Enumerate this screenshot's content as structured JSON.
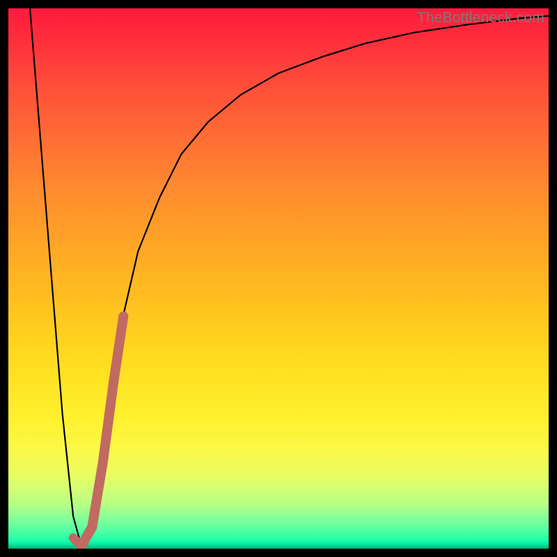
{
  "watermark": "TheBottleneck.com",
  "colors": {
    "thin_curve": "#000000",
    "thick_segment": "#c16a61",
    "frame": "#000000"
  },
  "chart_data": {
    "type": "line",
    "title": "",
    "xlabel": "",
    "ylabel": "",
    "xlim": [
      0,
      100
    ],
    "ylim": [
      0,
      100
    ],
    "series": [
      {
        "name": "bottleneck_curve",
        "x": [
          4,
          6,
          8,
          10,
          12,
          13.5,
          15,
          17,
          19,
          21,
          24,
          28,
          32,
          37,
          43,
          50,
          58,
          66,
          75,
          85,
          95,
          100
        ],
        "y": [
          100,
          75,
          50,
          25,
          6,
          0.5,
          3,
          15,
          30,
          42,
          55,
          65,
          73,
          79,
          84,
          88,
          91,
          93.5,
          95.5,
          97,
          98.2,
          98.6
        ]
      },
      {
        "name": "highlight_segment",
        "x": [
          12,
          13.5,
          15.5,
          17.5,
          19.5,
          21.3
        ],
        "y": [
          2,
          0.5,
          4,
          16,
          31,
          43
        ]
      }
    ],
    "background_gradient": {
      "top": "#ff1a3d",
      "mid_upper": "#ff8730",
      "mid": "#ffd21e",
      "mid_lower": "#fbf94a",
      "bottom": "#00b47e"
    }
  }
}
